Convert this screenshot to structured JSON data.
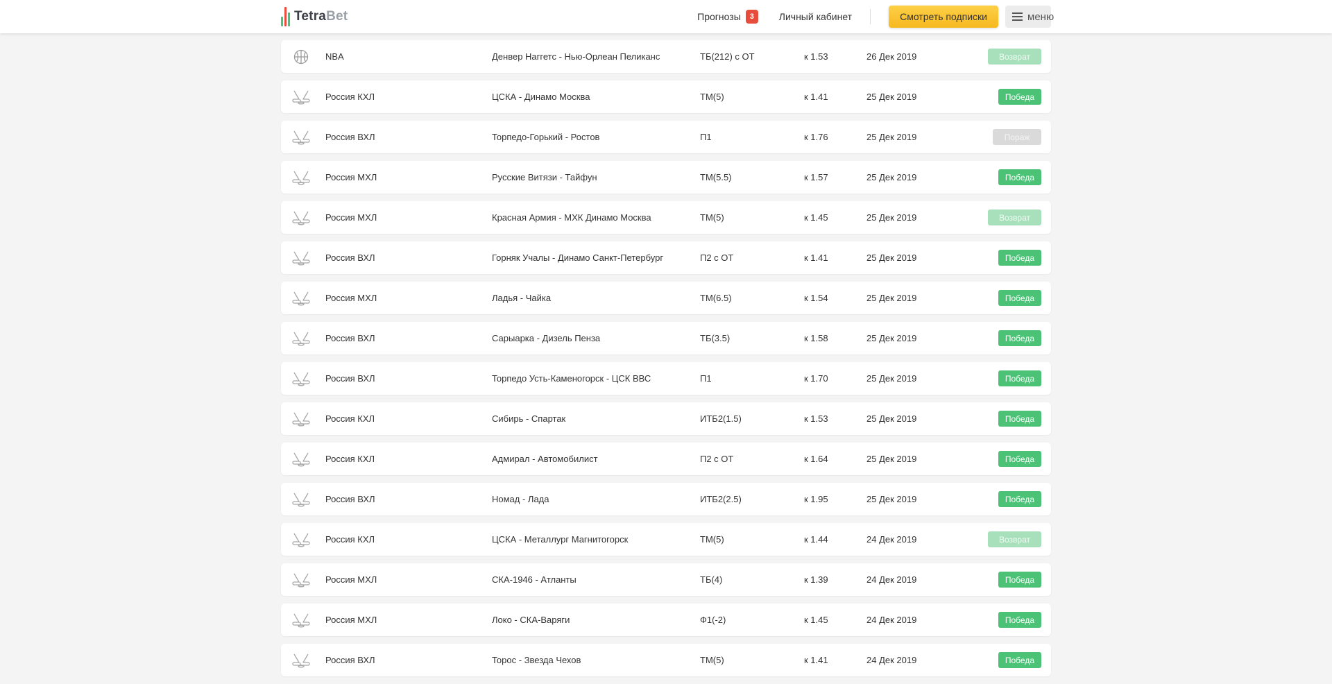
{
  "header": {
    "logo_prefix": "Tetra",
    "logo_suffix": "Bet",
    "logo_colors": [
      "#4cc276",
      "#e74c3c",
      "#4cc276",
      "#f6b820"
    ],
    "forecasts_label": "Прогнозы",
    "forecasts_count": "3",
    "cabinet_label": "Личный кабинет",
    "subscribe_label": "Смотреть подписки",
    "menu_label": "меню"
  },
  "colors": {
    "win": "#4cc276",
    "refund": "#a8e0bc",
    "loss": "#dadada",
    "accent": "#f6b820",
    "badge": "#e74c3c"
  },
  "rows": [
    {
      "sport_icon": "basketball-icon",
      "league": "NBA",
      "match": "Денвер Наггетс - Нью-Орлеан Пеликанс",
      "bet": "ТБ(212) с ОТ",
      "odds": "к 1.53",
      "date": "26 Дек 2019",
      "result": "Возврат",
      "status": "refund"
    },
    {
      "sport_icon": "hockey-icon",
      "league": "Россия КХЛ",
      "match": "ЦСКА - Динамо Москва",
      "bet": "ТМ(5)",
      "odds": "к 1.41",
      "date": "25 Дек 2019",
      "result": "Победа",
      "status": "win"
    },
    {
      "sport_icon": "hockey-icon",
      "league": "Россия ВХЛ",
      "match": "Торпедо-Горький - Ростов",
      "bet": "П1",
      "odds": "к 1.76",
      "date": "25 Дек 2019",
      "result": "Пораж",
      "status": "loss"
    },
    {
      "sport_icon": "hockey-icon",
      "league": "Россия МХЛ",
      "match": "Русские Витязи - Тайфун",
      "bet": "ТМ(5.5)",
      "odds": "к 1.57",
      "date": "25 Дек 2019",
      "result": "Победа",
      "status": "win"
    },
    {
      "sport_icon": "hockey-icon",
      "league": "Россия МХЛ",
      "match": "Красная Армия - МХК Динамо Москва",
      "bet": "ТМ(5)",
      "odds": "к 1.45",
      "date": "25 Дек 2019",
      "result": "Возврат",
      "status": "refund"
    },
    {
      "sport_icon": "hockey-icon",
      "league": "Россия ВХЛ",
      "match": "Горняк Учалы - Динамо Санкт-Петербург",
      "bet": "П2 с ОТ",
      "odds": "к 1.41",
      "date": "25 Дек 2019",
      "result": "Победа",
      "status": "win"
    },
    {
      "sport_icon": "hockey-icon",
      "league": "Россия МХЛ",
      "match": "Ладья - Чайка",
      "bet": "ТМ(6.5)",
      "odds": "к 1.54",
      "date": "25 Дек 2019",
      "result": "Победа",
      "status": "win"
    },
    {
      "sport_icon": "hockey-icon",
      "league": "Россия ВХЛ",
      "match": "Сарыарка - Дизель Пенза",
      "bet": "ТБ(3.5)",
      "odds": "к 1.58",
      "date": "25 Дек 2019",
      "result": "Победа",
      "status": "win"
    },
    {
      "sport_icon": "hockey-icon",
      "league": "Россия ВХЛ",
      "match": "Торпедо Усть-Каменогорск - ЦСК ВВС",
      "bet": "П1",
      "odds": "к 1.70",
      "date": "25 Дек 2019",
      "result": "Победа",
      "status": "win"
    },
    {
      "sport_icon": "hockey-icon",
      "league": "Россия КХЛ",
      "match": "Сибирь - Спартак",
      "bet": "ИТБ2(1.5)",
      "odds": "к 1.53",
      "date": "25 Дек 2019",
      "result": "Победа",
      "status": "win"
    },
    {
      "sport_icon": "hockey-icon",
      "league": "Россия КХЛ",
      "match": "Адмирал - Автомобилист",
      "bet": "П2 с ОТ",
      "odds": "к 1.64",
      "date": "25 Дек 2019",
      "result": "Победа",
      "status": "win"
    },
    {
      "sport_icon": "hockey-icon",
      "league": "Россия ВХЛ",
      "match": "Номад - Лада",
      "bet": "ИТБ2(2.5)",
      "odds": "к 1.95",
      "date": "25 Дек 2019",
      "result": "Победа",
      "status": "win"
    },
    {
      "sport_icon": "hockey-icon",
      "league": "Россия КХЛ",
      "match": "ЦСКА - Металлург Магнитогорск",
      "bet": "ТМ(5)",
      "odds": "к 1.44",
      "date": "24 Дек 2019",
      "result": "Возврат",
      "status": "refund"
    },
    {
      "sport_icon": "hockey-icon",
      "league": "Россия МХЛ",
      "match": "СКА-1946 - Атланты",
      "bet": "ТБ(4)",
      "odds": "к 1.39",
      "date": "24 Дек 2019",
      "result": "Победа",
      "status": "win"
    },
    {
      "sport_icon": "hockey-icon",
      "league": "Россия МХЛ",
      "match": "Локо - СКА-Варяги",
      "bet": "Ф1(-2)",
      "odds": "к 1.45",
      "date": "24 Дек 2019",
      "result": "Победа",
      "status": "win"
    },
    {
      "sport_icon": "hockey-icon",
      "league": "Россия ВХЛ",
      "match": "Торос - Звезда Чехов",
      "bet": "ТМ(5)",
      "odds": "к 1.41",
      "date": "24 Дек 2019",
      "result": "Победа",
      "status": "win"
    }
  ]
}
